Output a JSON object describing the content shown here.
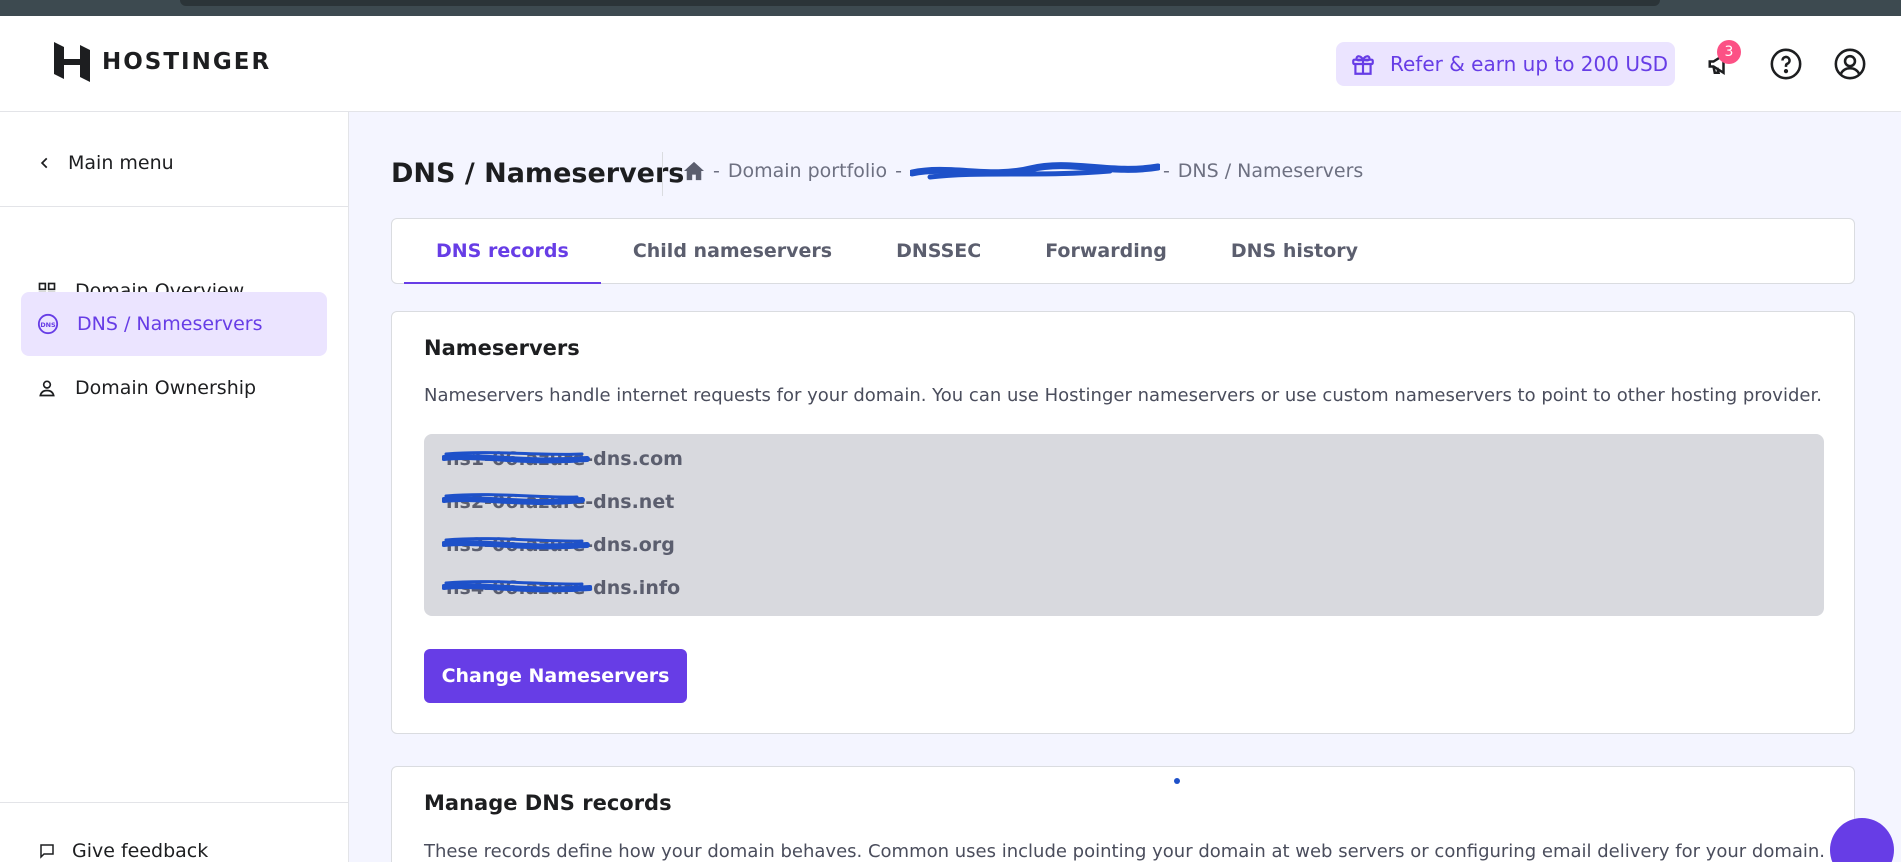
{
  "header": {
    "logo_text": "HOSTINGER",
    "refer_label": "Refer & earn up to 200 USD",
    "notification_count": "3"
  },
  "sidebar": {
    "main_menu_label": "Main menu",
    "items": [
      {
        "label": "Domain Overview",
        "icon": "grid-icon"
      },
      {
        "label": "DNS / Nameservers",
        "icon": "dns-icon",
        "active": true
      },
      {
        "label": "Domain Ownership",
        "icon": "user-icon"
      }
    ],
    "feedback_label": "Give feedback"
  },
  "page": {
    "title": "DNS / Nameservers",
    "breadcrumb": {
      "sep1": "-",
      "portfolio": "Domain portfolio",
      "sep2": "-",
      "domain": "d...cloud",
      "sep3": "-",
      "current": "DNS / Nameservers"
    }
  },
  "tabs": [
    {
      "label": "DNS records",
      "active": true
    },
    {
      "label": "Child nameservers"
    },
    {
      "label": "DNSSEC"
    },
    {
      "label": "Forwarding"
    },
    {
      "label": "DNS history"
    }
  ],
  "nameservers_card": {
    "title": "Nameservers",
    "description": "Nameservers handle internet requests for your domain. You can use Hostinger nameservers or use custom nameservers to point to other hosting provider.",
    "nameservers": [
      "ns1-06.azure-dns.com",
      "ns2-06.azure-dns.net",
      "ns3-06.azure-dns.org",
      "ns4-06.azure-dns.info"
    ],
    "button_label": "Change Nameservers"
  },
  "dns_card": {
    "title": "Manage DNS records",
    "description": "These records define how your domain behaves. Common uses include pointing your domain at web servers or configuring email delivery for your domain."
  },
  "colors": {
    "accent": "#673de6",
    "accent_light": "#ebe4ff",
    "badge": "#fc5185",
    "redaction": "#1e51c9"
  }
}
